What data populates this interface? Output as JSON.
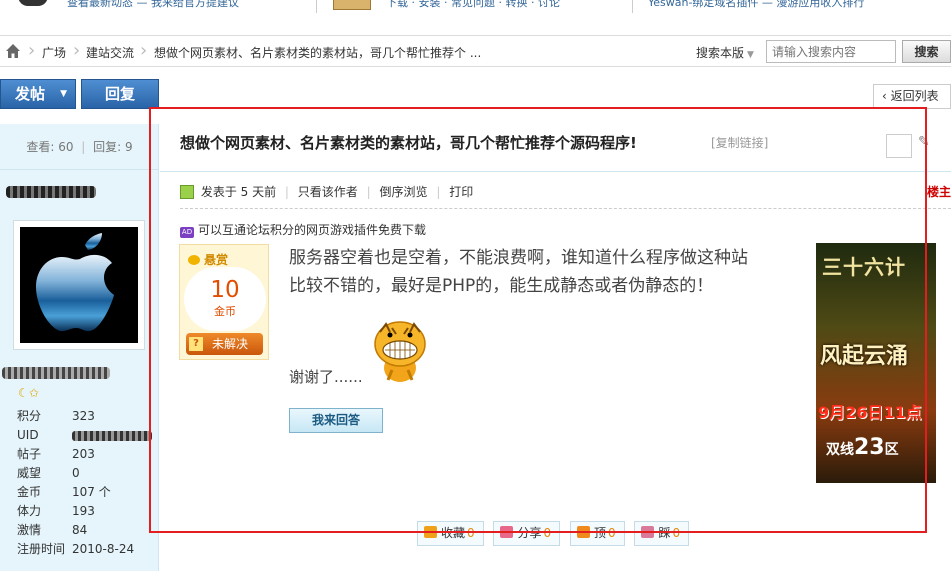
{
  "topbar": {
    "links_left": "查看最新动态 — 我来给官方提建议",
    "links_mid": "下载 · 安装 · 常见问题 · 转换 · 讨论",
    "links_right": "Yeswan-绑定域名插件 — 漫游应用收入排行"
  },
  "breadcrumb": {
    "items": [
      "广场",
      "建站交流",
      "想做个网页素材、名片素材类的素材站，哥几个帮忙推荐个 ..."
    ]
  },
  "search": {
    "edition_label": "搜索本版",
    "placeholder": "请输入搜索内容",
    "button_label": "搜索"
  },
  "actions_top": {
    "post_label": "发帖",
    "reply_label": "回复",
    "back_label": "返回列表"
  },
  "stats": {
    "views_label": "查看:",
    "views": "60",
    "replies_label": "回复:",
    "replies": "9"
  },
  "user": {
    "info": [
      {
        "key": "积分",
        "value": "323"
      },
      {
        "key": "UID",
        "value": ""
      },
      {
        "key": "帖子",
        "value": "203"
      },
      {
        "key": "威望",
        "value": "0"
      },
      {
        "key": "金币",
        "value": "107 个"
      },
      {
        "key": "体力",
        "value": "193"
      },
      {
        "key": "激情",
        "value": "84"
      },
      {
        "key": "注册时间",
        "value": "2010-8-24"
      }
    ]
  },
  "post": {
    "title": "想做个网页素材、名片素材类的素材站，哥几个帮忙推荐个源码程序!",
    "copy_link": "[复制链接]",
    "meta": {
      "posted": "发表于 5 天前",
      "author_only": "只看该作者",
      "reverse": "倒序浏览",
      "print": "打印",
      "floor": "楼主"
    },
    "ad_text": "可以互通论坛积分的网页游戏插件免费下载",
    "reward": {
      "header": "悬赏",
      "amount": "10",
      "unit": "金币",
      "status": "未解决"
    },
    "content_line1": "服务器空着也是空着，不能浪费啊，谁知道什么程序做这种站",
    "content_line2": "比较不错的，最好是PHP的，能生成静态或者伪静态的！",
    "thanks": "谢谢了......",
    "answer_button": "我来回答",
    "game_ad": {
      "line1": "三十六计",
      "line2": "风起云涌",
      "line3": "9月26日11点",
      "line4_prefix": "双线",
      "line4_num": "23",
      "line4_suffix": "区"
    },
    "buttons": [
      {
        "label": "收藏",
        "count": "0",
        "color": "#f0a11a"
      },
      {
        "label": "分享",
        "count": "0",
        "color": "#e8688a"
      },
      {
        "label": "顶",
        "count": "0",
        "color": "#f08a1a"
      },
      {
        "label": "踩",
        "count": "0",
        "color": "#d97a9a"
      }
    ]
  },
  "colors": {
    "highlight_frame": "#e41e1e",
    "side_bg": "#e5f5fb",
    "button_blue": "#2a64a8"
  }
}
